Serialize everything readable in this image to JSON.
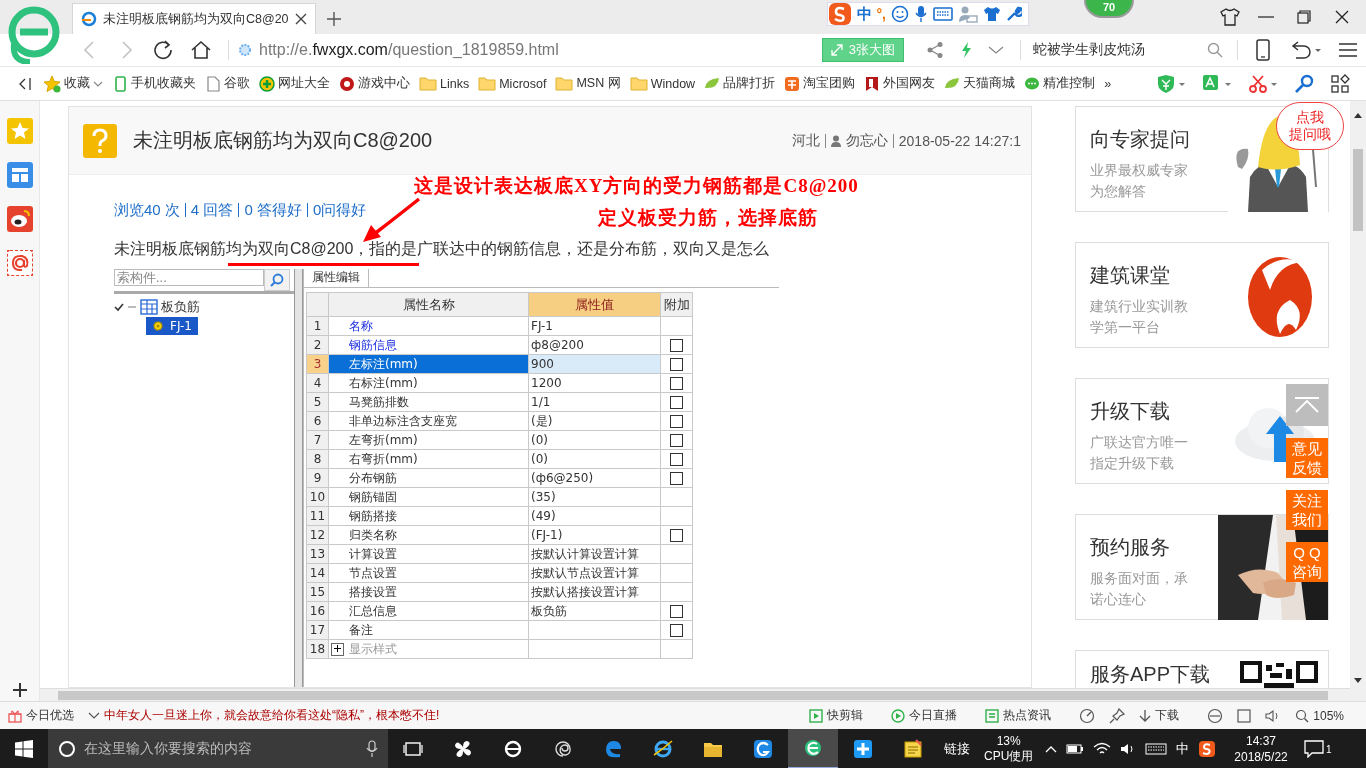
{
  "browser": {
    "tab": {
      "title": "未注明板底钢筋均为双向C8@20"
    },
    "ime": {
      "mode": "中",
      "punctuation": "°,"
    },
    "badge": "70",
    "address": {
      "scheme": "http://e.",
      "domain": "fwxgx.com",
      "path": "/question_1819859.html"
    },
    "images_button": "3张大图",
    "search": {
      "value": "蛇被学生剥皮炖汤"
    },
    "bookmarks": [
      {
        "label": "收藏",
        "kind": "menu"
      },
      {
        "label": "手机收藏夹",
        "kind": "site"
      },
      {
        "label": "谷歌",
        "kind": "site"
      },
      {
        "label": "网址大全",
        "kind": "site"
      },
      {
        "label": "游戏中心",
        "kind": "site"
      },
      {
        "label": "Links",
        "kind": "folder"
      },
      {
        "label": "Microsof",
        "kind": "folder"
      },
      {
        "label": "MSN 网",
        "kind": "folder"
      },
      {
        "label": "Window",
        "kind": "folder"
      },
      {
        "label": "品牌打折",
        "kind": "site"
      },
      {
        "label": "淘宝团购",
        "kind": "site"
      },
      {
        "label": "外国网友",
        "kind": "site"
      },
      {
        "label": "天猫商城",
        "kind": "site"
      },
      {
        "label": "精准控制",
        "kind": "site"
      },
      {
        "label": "»",
        "kind": "more"
      }
    ]
  },
  "question": {
    "title": "未注明板底钢筋均为双向C8@200",
    "location": "河北",
    "user": "勿忘心",
    "time": "2018-05-22 14:27:1",
    "stats": [
      "浏览40 次",
      "4 回答",
      "0 答得好",
      "0问得好"
    ],
    "annotation": [
      "这是设计表达板底XY方向的受力钢筋都是C8@200",
      "定义板受力筋，选择底筋"
    ],
    "text": "未注明板底钢筋均为双向C8@200，指的是广联达中的钢筋信息，还是分布筋，双向又是怎么"
  },
  "software": {
    "search_placeholder": "索构件...",
    "tree": [
      {
        "label": "板负筋",
        "checked": true,
        "expanded": true,
        "children": [
          {
            "label": "FJ-1",
            "selected": true
          }
        ]
      }
    ],
    "tab": "属性编辑",
    "columns": [
      "属性名称",
      "属性值",
      "附加"
    ],
    "rows": [
      {
        "num": "1",
        "name": "名称",
        "value": "FJ-1",
        "kind": "property",
        "emphasized": true,
        "selected": false
      },
      {
        "num": "2",
        "name": "钢筋信息",
        "value": "ф8@200",
        "kind": "property",
        "emphasized": true,
        "selected": false,
        "checked": false
      },
      {
        "num": "3",
        "name": "左标注(mm)",
        "value": "900",
        "kind": "property",
        "emphasized": false,
        "selected": true,
        "checked": false
      },
      {
        "num": "4",
        "name": "右标注(mm)",
        "value": "1200",
        "kind": "property",
        "emphasized": false,
        "selected": false,
        "checked": false
      },
      {
        "num": "5",
        "name": "马凳筋排数",
        "value": "1/1",
        "kind": "property",
        "emphasized": false,
        "selected": false,
        "checked": false
      },
      {
        "num": "6",
        "name": "非单边标注含支座宽",
        "value": "(是)",
        "kind": "property",
        "emphasized": false,
        "selected": false,
        "checked": false
      },
      {
        "num": "7",
        "name": "左弯折(mm)",
        "value": "(0)",
        "kind": "property",
        "emphasized": false,
        "selected": false,
        "checked": false
      },
      {
        "num": "8",
        "name": "右弯折(mm)",
        "value": "(0)",
        "kind": "property",
        "emphasized": false,
        "selected": false,
        "checked": false
      },
      {
        "num": "9",
        "name": "分布钢筋",
        "value": "(ф6@250)",
        "kind": "property",
        "emphasized": false,
        "selected": false,
        "checked": false
      },
      {
        "num": "10",
        "name": "钢筋锚固",
        "value": "(35)",
        "kind": "property",
        "emphasized": false,
        "selected": false
      },
      {
        "num": "11",
        "name": "钢筋搭接",
        "value": "(49)",
        "kind": "property",
        "emphasized": false,
        "selected": false
      },
      {
        "num": "12",
        "name": "归类名称",
        "value": "(FJ-1)",
        "kind": "property",
        "emphasized": false,
        "selected": false,
        "checked": false
      },
      {
        "num": "13",
        "name": "计算设置",
        "value": "按默认计算设置计算",
        "kind": "property",
        "emphasized": false,
        "selected": false
      },
      {
        "num": "14",
        "name": "节点设置",
        "value": "按默认节点设置计算",
        "kind": "property",
        "emphasized": false,
        "selected": false
      },
      {
        "num": "15",
        "name": "搭接设置",
        "value": "按默认搭接设置计算",
        "kind": "property",
        "emphasized": false,
        "selected": false
      },
      {
        "num": "16",
        "name": "汇总信息",
        "value": "板负筋",
        "kind": "property",
        "emphasized": false,
        "selected": false,
        "checked": false
      },
      {
        "num": "17",
        "name": "备注",
        "kind": "property",
        "emphasized": false,
        "selected": false,
        "checked": false
      },
      {
        "num": "18",
        "name": "显示样式",
        "kind": "group",
        "emphasized": false,
        "selected": false,
        "expanded": false
      }
    ]
  },
  "sidebar": {
    "cards": [
      {
        "title": "向专家提问",
        "text": "业界最权威专家为您解答",
        "bubble": [
          "点我",
          "提问哦"
        ]
      },
      {
        "title": "建筑课堂",
        "text": "建筑行业实训教学第一平台"
      },
      {
        "title": "升级下载",
        "text": "广联达官方唯一指定升级下载"
      },
      {
        "title": "预约服务",
        "text": "服务面对面，承诺心连心"
      },
      {
        "title": "服务APP下载"
      }
    ],
    "float_buttons": [
      "意见反馈",
      "关注我们",
      "Q Q咨询"
    ]
  },
  "status_bar": {
    "label": "今日优选",
    "news": "中年女人一旦迷上你，就会故意给你看这处“隐私”，根本憋不住!",
    "items": [
      {
        "label": "快剪辑"
      },
      {
        "label": "今日直播"
      },
      {
        "label": "热点资讯"
      }
    ],
    "download": "下载",
    "zoom": "105%"
  },
  "taskbar": {
    "search_placeholder": "在这里输入你要搜索的内容",
    "apps": [
      {
        "active": false
      },
      {
        "active": false
      },
      {
        "active": false
      },
      {
        "active": false
      },
      {
        "active": false
      },
      {
        "active": false
      },
      {
        "active": false
      },
      {
        "active": false
      },
      {
        "active": true
      },
      {
        "active": false
      },
      {
        "active": false
      }
    ],
    "links": "链接",
    "cpu_value": "13%",
    "cpu_label": "CPU使用",
    "ime": "中",
    "time": "14:37",
    "date": "2018/5/22",
    "notifications": "1"
  }
}
